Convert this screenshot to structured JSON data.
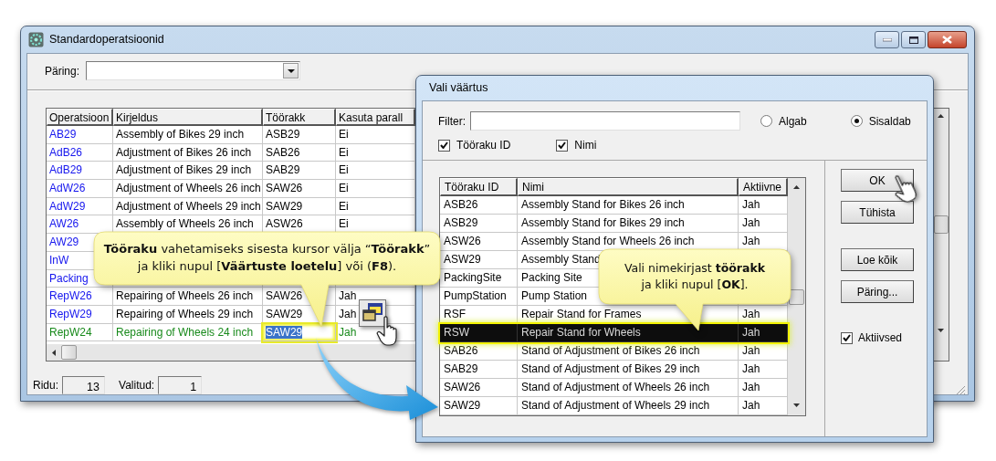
{
  "main_window": {
    "title": "Standardoperatsioonid",
    "query_label": "Päring:",
    "table": {
      "columns": [
        "Operatsioon",
        "Kirjeldus",
        "Töörakk",
        "Kasuta parall"
      ],
      "rows": [
        {
          "operation": "AB29",
          "description": "Assembly of Bikes 29 inch",
          "workcell": "ASB29",
          "parallel": "Ei",
          "current": false,
          "editing": false
        },
        {
          "operation": "AdB26",
          "description": "Adjustment of Bikes 26 inch",
          "workcell": "SAB26",
          "parallel": "Ei",
          "current": false,
          "editing": false
        },
        {
          "operation": "AdB29",
          "description": "Adjustment of Bikes 29 inch",
          "workcell": "SAB29",
          "parallel": "Ei",
          "current": false,
          "editing": false
        },
        {
          "operation": "AdW26",
          "description": "Adjustment of Wheels 26 inch",
          "workcell": "SAW26",
          "parallel": "Ei",
          "current": false,
          "editing": false
        },
        {
          "operation": "AdW29",
          "description": "Adjustment of Wheels 29 inch",
          "workcell": "SAW29",
          "parallel": "Ei",
          "current": false,
          "editing": false
        },
        {
          "operation": "AW26",
          "description": "Assembly of Wheels 26 inch",
          "workcell": "ASW26",
          "parallel": "Ei",
          "current": false,
          "editing": false
        },
        {
          "operation": "AW29",
          "current": false
        },
        {
          "operation": "InW",
          "current": false
        },
        {
          "operation": "Packing",
          "current": false
        },
        {
          "operation": "RepW26",
          "description": "Repairing of Wheels 26 inch",
          "workcell": "SAW26",
          "parallel": "Jah",
          "current": false,
          "editing": false
        },
        {
          "operation": "RepW29",
          "description": "Repairing of Wheels 29 inch",
          "workcell": "SAW29",
          "parallel": "Jah",
          "current": false,
          "editing": false
        },
        {
          "operation": "RepW24",
          "description": "Repairing of Wheels 24 inch",
          "workcell": "SAW29",
          "parallel": "Jah",
          "current": true,
          "editing": true
        }
      ]
    },
    "status": [
      {
        "label": "Ridu:",
        "value": "13"
      },
      {
        "label": "Valitud:",
        "value": "1"
      }
    ]
  },
  "dialog": {
    "title": "Vali väärtus",
    "filter_label": "Filter:",
    "radios": [
      {
        "label": "Algab",
        "selected": false
      },
      {
        "label": "Sisaldab",
        "selected": true
      }
    ],
    "checkboxes": [
      {
        "label": "Tööraku ID",
        "checked": true
      },
      {
        "label": "Nimi",
        "checked": true
      }
    ],
    "table": {
      "columns": [
        "Tööraku ID",
        "Nimi",
        "Aktiivne"
      ],
      "rows": [
        {
          "id": "ASB26",
          "name": "Assembly Stand for Bikes 26 inch",
          "active": "Jah",
          "selected": false
        },
        {
          "id": "ASB29",
          "name": "Assembly Stand for Bikes 29 inch",
          "active": "Jah",
          "selected": false
        },
        {
          "id": "ASW26",
          "name": "Assembly Stand for Wheels 26 inch",
          "active": "Jah",
          "selected": false
        },
        {
          "id": "ASW29",
          "name": "Assembly Stand",
          "selected": false
        },
        {
          "id": "PackingSite",
          "name": "Packing Site",
          "selected": false
        },
        {
          "id": "PumpStation",
          "name": "Pump Station",
          "selected": false
        },
        {
          "id": "RSF",
          "name": "Repair Stand for Frames",
          "active": "Jah",
          "selected": false
        },
        {
          "id": "RSW",
          "name": "Repair Stand for Wheels",
          "active": "Jah",
          "selected": true
        },
        {
          "id": "SAB26",
          "name": "Stand of Adjustment of Bikes 26 inch",
          "active": "Jah",
          "selected": false
        },
        {
          "id": "SAB29",
          "name": "Stand of Adjustment of Bikes 29 inch",
          "active": "Jah",
          "selected": false
        },
        {
          "id": "SAW26",
          "name": "Stand of Adjustment of Wheels 26 inch",
          "active": "Jah",
          "selected": false
        },
        {
          "id": "SAW29",
          "name": "Stand of Adjustment of Wheels 29 inch",
          "active": "Jah",
          "selected": false
        }
      ]
    },
    "buttons": [
      "OK",
      "Tühista",
      "Loe kõik",
      "Päring..."
    ],
    "active_only": {
      "label": "Aktiivsed",
      "checked": true
    }
  },
  "callouts": [
    {
      "text": "**Tööraku** vahetamiseks sisesta kursor välja “**Töörakk**”\nja kliki nupul [**Väärtuste loetelu**] või (**F8**)."
    },
    {
      "text": "Vali nimekirjast **töörakk**\nja kliki nupul [**OK**]."
    }
  ]
}
